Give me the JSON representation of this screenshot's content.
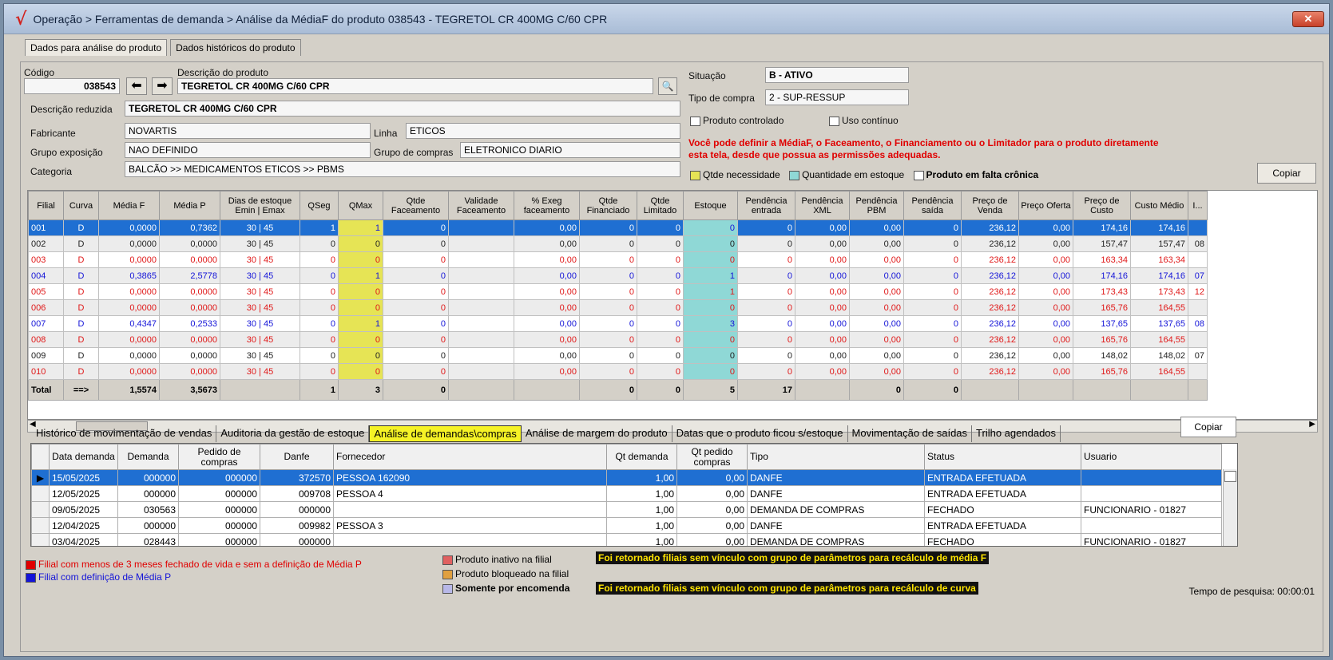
{
  "window": {
    "title": "Operação > Ferramentas de demanda > Análise da MédiaF do produto 038543 - TEGRETOL CR 400MG C/60 CPR",
    "close_label": "✕"
  },
  "top_tabs": [
    "Dados para análise do produto",
    "Dados históricos do produto"
  ],
  "product": {
    "codigo_label": "Código",
    "codigo": "038543",
    "descricao_label": "Descrição do produto",
    "descricao": "TEGRETOL CR 400MG C/60 CPR",
    "descricao_reduzida_label": "Descrição reduzida",
    "descricao_reduzida": "TEGRETOL CR 400MG C/60 CPR",
    "fabricante_label": "Fabricante",
    "fabricante": "NOVARTIS",
    "linha_label": "Linha",
    "linha": "ETICOS",
    "grupo_exposicao_label": "Grupo exposição",
    "grupo_exposicao": "NAO DEFINIDO",
    "grupo_compras_label": "Grupo de compras",
    "grupo_compras": "ELETRONICO DIARIO",
    "categoria_label": "Categoria",
    "categoria": "BALCÃO >> MEDICAMENTOS ETICOS >> PBMS",
    "situacao_label": "Situação",
    "situacao": "B - ATIVO",
    "tipo_compra_label": "Tipo de compra",
    "tipo_compra": "2 - SUP-RESSUP",
    "produto_controlado_label": "Produto controlado",
    "uso_continuo_label": "Uso contínuo"
  },
  "warning": {
    "line1": "Você pode definir a MédiaF, o Faceamento, o Financiamento ou o Limitador para o produto diretamente",
    "line2": "esta tela, desde que possua as permissões adequadas."
  },
  "color_legend": {
    "qtde_necessidade": "Qtde necessidade",
    "quantidade_estoque": "Quantidade em estoque",
    "falta_cronica": "Produto em falta crônica",
    "copy_label": "Copiar"
  },
  "grid_headers": [
    "Filial",
    "Curva",
    "Média F",
    "Média P",
    "Dias de estoque Emin | Emax",
    "QSeg",
    "QMax",
    "Qtde Faceamento",
    "Validade Faceamento",
    "% Exeg faceamento",
    "Qtde Financiado",
    "Qtde Limitado",
    "Estoque",
    "Pendência entrada",
    "Pendência XML",
    "Pendência PBM",
    "Pendência saída",
    "Preço de Venda",
    "Preço Oferta",
    "Preço de Custo",
    "Custo Médio",
    "I..."
  ],
  "grid_rows": [
    {
      "style": "sel",
      "cells": [
        "001",
        "D",
        "0,0000",
        "0,7362",
        "30  |  45",
        "1",
        "1",
        "0",
        "",
        "0,00",
        "0",
        "0",
        "0",
        "0",
        "0,00",
        "0,00",
        "0",
        "236,12",
        "0,00",
        "174,16",
        "174,16",
        ""
      ]
    },
    {
      "style": "black",
      "cells": [
        "002",
        "D",
        "0,0000",
        "0,0000",
        "30  |  45",
        "0",
        "0",
        "0",
        "",
        "0,00",
        "0",
        "0",
        "0",
        "0",
        "0,00",
        "0,00",
        "0",
        "236,12",
        "0,00",
        "157,47",
        "157,47",
        "08"
      ]
    },
    {
      "style": "red",
      "cells": [
        "003",
        "D",
        "0,0000",
        "0,0000",
        "30  |  45",
        "0",
        "0",
        "0",
        "",
        "0,00",
        "0",
        "0",
        "0",
        "0",
        "0,00",
        "0,00",
        "0",
        "236,12",
        "0,00",
        "163,34",
        "163,34",
        ""
      ]
    },
    {
      "style": "blue",
      "cells": [
        "004",
        "D",
        "0,3865",
        "2,5778",
        "30  |  45",
        "0",
        "1",
        "0",
        "",
        "0,00",
        "0",
        "0",
        "1",
        "0",
        "0,00",
        "0,00",
        "0",
        "236,12",
        "0,00",
        "174,16",
        "174,16",
        "07"
      ]
    },
    {
      "style": "red",
      "cells": [
        "005",
        "D",
        "0,0000",
        "0,0000",
        "30  |  45",
        "0",
        "0",
        "0",
        "",
        "0,00",
        "0",
        "0",
        "1",
        "0",
        "0,00",
        "0,00",
        "0",
        "236,12",
        "0,00",
        "173,43",
        "173,43",
        "12"
      ]
    },
    {
      "style": "red",
      "cells": [
        "006",
        "D",
        "0,0000",
        "0,0000",
        "30  |  45",
        "0",
        "0",
        "0",
        "",
        "0,00",
        "0",
        "0",
        "0",
        "0",
        "0,00",
        "0,00",
        "0",
        "236,12",
        "0,00",
        "165,76",
        "164,55",
        ""
      ]
    },
    {
      "style": "blue",
      "cells": [
        "007",
        "D",
        "0,4347",
        "0,2533",
        "30  |  45",
        "0",
        "1",
        "0",
        "",
        "0,00",
        "0",
        "0",
        "3",
        "0",
        "0,00",
        "0,00",
        "0",
        "236,12",
        "0,00",
        "137,65",
        "137,65",
        "08"
      ]
    },
    {
      "style": "red",
      "cells": [
        "008",
        "D",
        "0,0000",
        "0,0000",
        "30  |  45",
        "0",
        "0",
        "0",
        "",
        "0,00",
        "0",
        "0",
        "0",
        "0",
        "0,00",
        "0,00",
        "0",
        "236,12",
        "0,00",
        "165,76",
        "164,55",
        ""
      ]
    },
    {
      "style": "black",
      "cells": [
        "009",
        "D",
        "0,0000",
        "0,0000",
        "30  |  45",
        "0",
        "0",
        "0",
        "",
        "0,00",
        "0",
        "0",
        "0",
        "0",
        "0,00",
        "0,00",
        "0",
        "236,12",
        "0,00",
        "148,02",
        "148,02",
        "07"
      ]
    },
    {
      "style": "red",
      "cells": [
        "010",
        "D",
        "0,0000",
        "0,0000",
        "30  |  45",
        "0",
        "0",
        "0",
        "",
        "0,00",
        "0",
        "0",
        "0",
        "0",
        "0,00",
        "0,00",
        "0",
        "236,12",
        "0,00",
        "165,76",
        "164,55",
        ""
      ]
    }
  ],
  "grid_total": [
    "Total",
    "==>",
    "1,5574",
    "3,5673",
    "",
    "1",
    "3",
    "0",
    "",
    "",
    "0",
    "0",
    "5",
    "17",
    "",
    "0",
    "0",
    "",
    "",
    "",
    "",
    ""
  ],
  "lower_tabs": [
    "Histórico de movimentação de vendas",
    "Auditoria da gestão de estoque",
    "Análise de demandas\\compras",
    "Análise de margem do produto",
    "Datas que o produto ficou s/estoque",
    "Movimentação de saídas",
    "Trilho agendados"
  ],
  "lower_copy_label": "Copiar",
  "demand_headers": [
    "Data demanda",
    "Demanda",
    "Pedido de compras",
    "Danfe",
    "Fornecedor",
    "Qt demanda",
    "Qt pedido compras",
    "Tipo",
    "Status",
    "Usuario"
  ],
  "demand_rows": [
    {
      "sel": true,
      "cells": [
        "15/05/2025",
        "000000",
        "000000",
        "372570",
        "PESSOA 162090",
        "1,00",
        "0,00",
        "DANFE",
        "ENTRADA EFETUADA",
        ""
      ]
    },
    {
      "sel": false,
      "cells": [
        "12/05/2025",
        "000000",
        "000000",
        "009708",
        "PESSOA 4",
        "1,00",
        "0,00",
        "DANFE",
        "ENTRADA EFETUADA",
        ""
      ]
    },
    {
      "sel": false,
      "cells": [
        "09/05/2025",
        "030563",
        "000000",
        "000000",
        "",
        "1,00",
        "0,00",
        "DEMANDA DE COMPRAS",
        "FECHADO",
        "FUNCIONARIO - 01827"
      ]
    },
    {
      "sel": false,
      "cells": [
        "12/04/2025",
        "000000",
        "000000",
        "009982",
        "PESSOA 3",
        "1,00",
        "0,00",
        "DANFE",
        "ENTRADA EFETUADA",
        ""
      ]
    },
    {
      "sel": false,
      "cells": [
        "03/04/2025",
        "028443",
        "000000",
        "000000",
        "",
        "1,00",
        "0,00",
        "DEMANDA DE COMPRAS",
        "FECHADO",
        "FUNCIONARIO - 01827"
      ]
    }
  ],
  "footer": {
    "legend_red": "Filial com menos de 3 meses fechado de vida e sem a definição de Média P",
    "legend_blue": "Filial com definição de Média P",
    "inativo": "Produto inativo na filial",
    "bloqueado": "Produto bloqueado na filial",
    "encomenda": "Somente por encomenda",
    "highlight1": "Foi retornado filiais sem vínculo com grupo de parâmetros para recálculo de média F",
    "highlight2": "Foi retornado filiais sem vínculo com grupo de parâmetros para recálculo de curva",
    "tempo_pesquisa": "Tempo de pesquisa: 00:00:01"
  },
  "colors": {
    "selection": "#1f6fd2",
    "necessidade": "#e6e455",
    "estoque": "#8fd8d6",
    "warning": "#e00000",
    "branch_red": "#e01818",
    "branch_blue": "#1414d8"
  }
}
